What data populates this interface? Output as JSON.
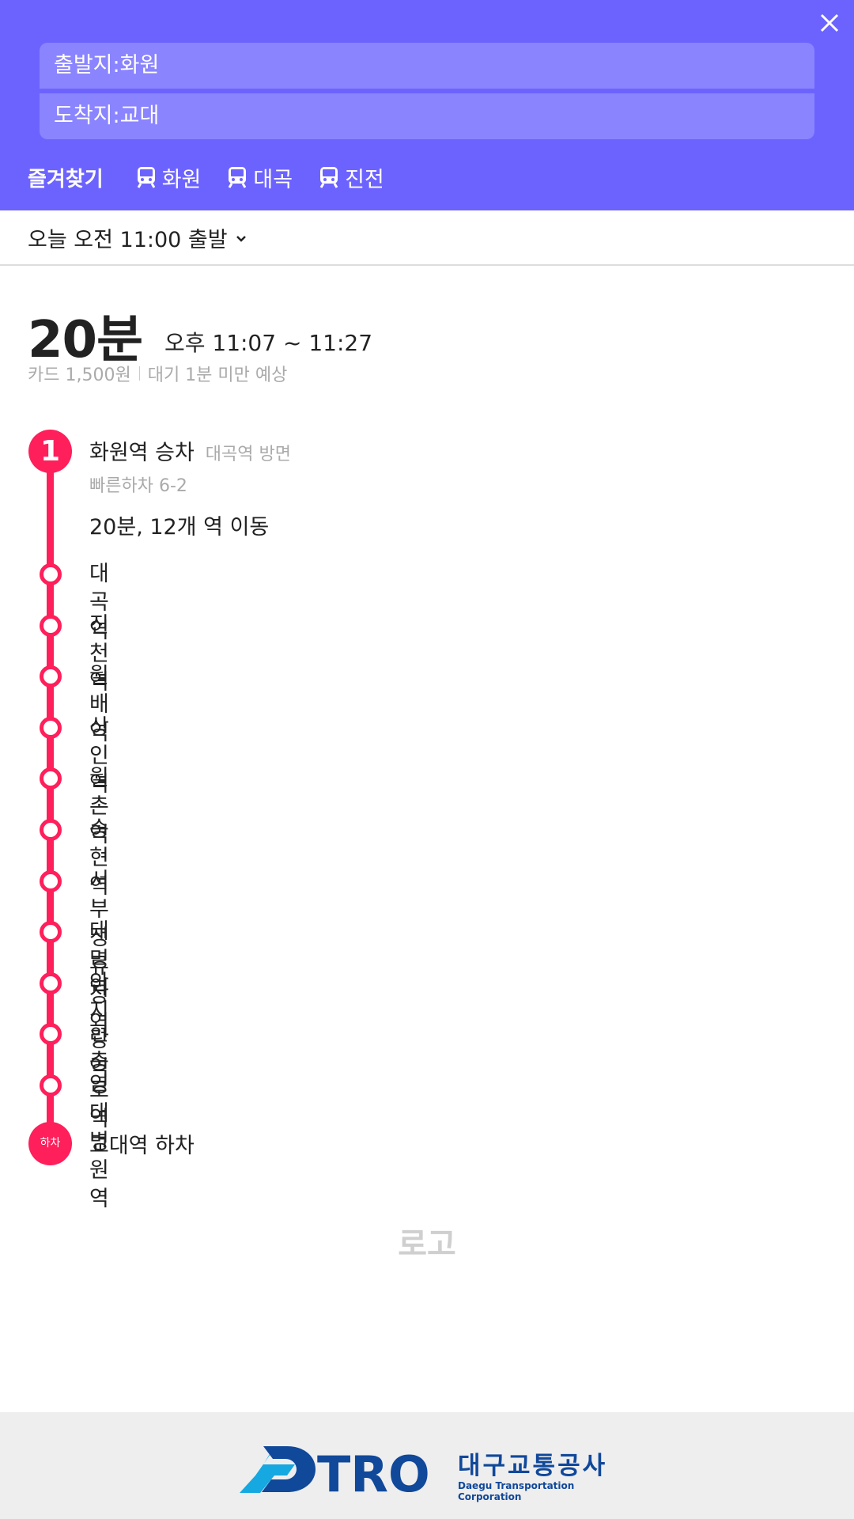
{
  "header": {
    "origin_label": "출발지:화원",
    "destination_label": "도착지:교대",
    "favorites_title": "즐겨찾기",
    "favorites": [
      {
        "label": "화원",
        "icon": "subway-icon"
      },
      {
        "label": "대곡",
        "icon": "subway-icon"
      },
      {
        "label": "진전",
        "icon": "subway-icon"
      }
    ],
    "close_icon": "close-icon"
  },
  "departure": {
    "label": "오늘 오전 11:00 출발",
    "icon": "chevron-down-icon"
  },
  "summary": {
    "duration": "20분",
    "time_range": "오후 11:07 ~ 11:27",
    "fare": "카드 1,500원",
    "wait": "대기 1분 미만 예상"
  },
  "route": {
    "step_number": "1",
    "board_station": "화원역 승차",
    "direction": "대곡역 방면",
    "quick_exit": "빠른하차 6-2",
    "move_info": "20분, 12개 역 이동",
    "stops": [
      "대곡역",
      "진천역",
      "월배역",
      "상인역",
      "월촌역",
      "송현역",
      "서부정류장역",
      "대명역",
      "안지랑역",
      "현충로역",
      "영대병원역"
    ],
    "alight_badge": "하차",
    "alight_station": "교대역 하차",
    "line_color": "#ff1f5a"
  },
  "logo_placeholder": "로고",
  "footer": {
    "brand_logo": "DTRO",
    "brand_korean": "대구교통공사",
    "brand_english": "Daegu Transportation Corporation"
  },
  "colors": {
    "header_bg": "#6c63ff",
    "input_bg": "#8a84ff",
    "accent": "#ff1f5a",
    "brand_blue": "#10489a"
  }
}
